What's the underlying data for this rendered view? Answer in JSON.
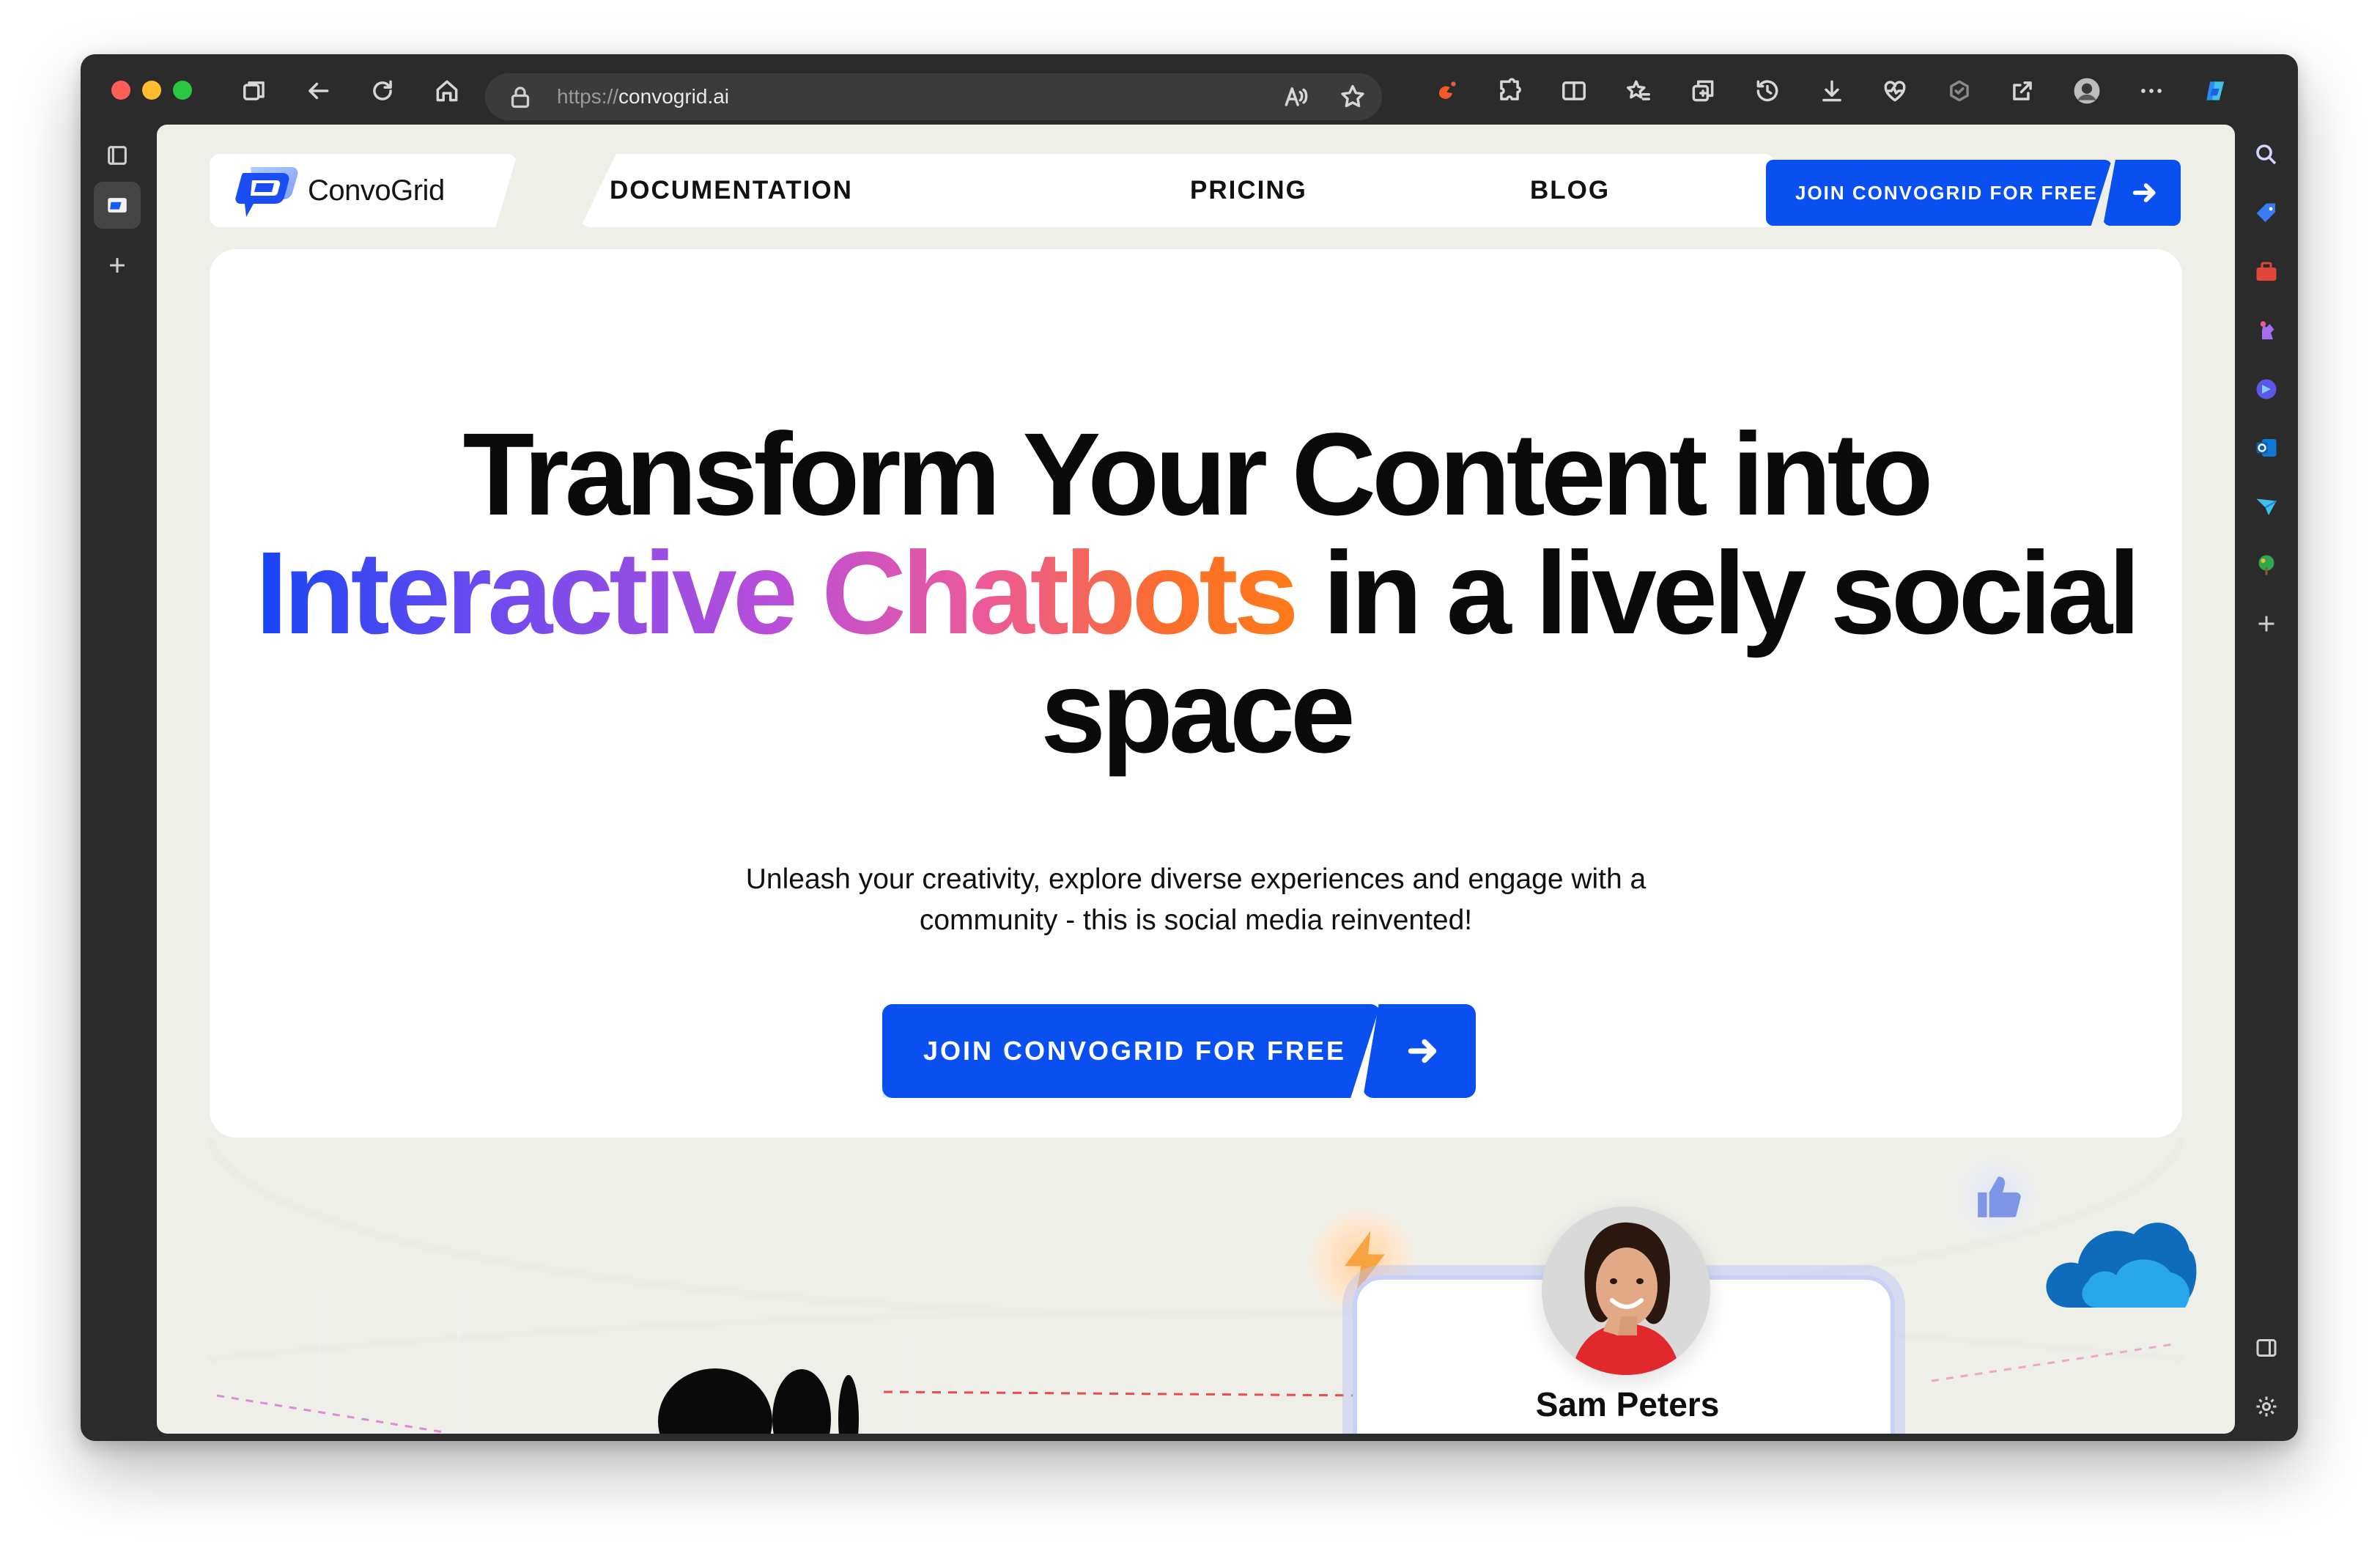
{
  "browser": {
    "url_protocol": "https://",
    "url_host": "convogrid.ai",
    "icons": [
      "tabs-icon",
      "back-icon",
      "reload-icon",
      "home-icon",
      "lock-icon",
      "read-aloud-icon",
      "favorite-icon",
      "extension-icon",
      "puzzle-icon",
      "split-screen-icon",
      "favorites-icon",
      "collections-icon",
      "history-icon",
      "downloads-icon",
      "performance-icon",
      "browser-essentials-icon",
      "share-icon",
      "profile-avatar-icon",
      "more-icon",
      "copilot-icon"
    ],
    "sidebar_icons": [
      "search-icon",
      "shopping-tag-icon",
      "tools-icon",
      "games-icon",
      "copilot-circle-icon",
      "outlook-icon",
      "send-icon",
      "tree-icon",
      "add-icon",
      "sidebar-toggle-icon",
      "settings-icon"
    ]
  },
  "site": {
    "brand": "ConvoGrid",
    "nav": {
      "links": [
        "DOCUMENTATION",
        "PRICING",
        "BLOG"
      ],
      "cta_label": "JOIN CONVOGRID FOR FREE"
    },
    "hero": {
      "headline_line1": "Transform Your Content into",
      "headline_gradient": "Interactive Chatbots",
      "headline_line2_rest": " in a lively social",
      "headline_line3": "space",
      "subtitle_line1": "Unleash your creativity, explore diverse experiences and engage with a",
      "subtitle_line2": "community - this is social media reinvented!",
      "cta_label": "JOIN CONVOGRID FOR FREE"
    },
    "preview": {
      "profile_name": "Sam Peters"
    }
  },
  "colors": {
    "accent": "#0a4ff0",
    "gradient_start": "#1746f5",
    "gradient_mid": "#b94ed9",
    "gradient_end": "#ff7a1a",
    "page_bg": "#efefe9"
  }
}
